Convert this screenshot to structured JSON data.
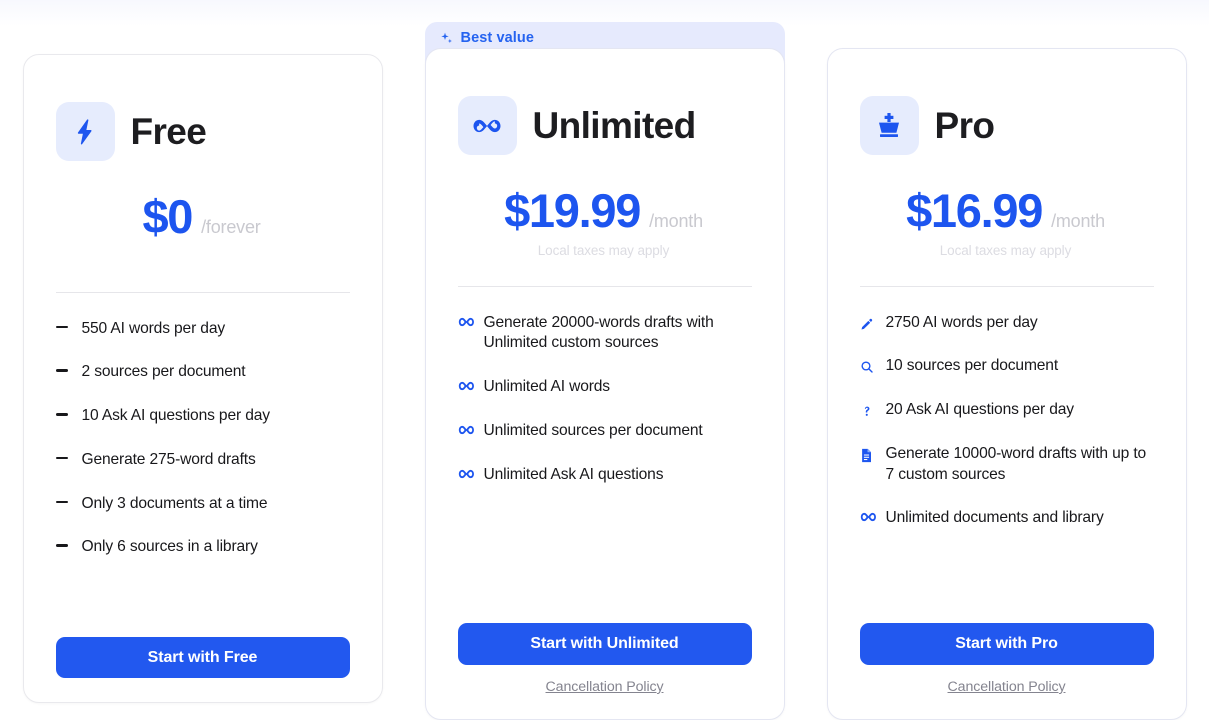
{
  "theme": {
    "accent_blue": "#1d55ef",
    "button_blue": "#2258ef",
    "icon_tile_bg": "#e6ecfd",
    "badge_bg": "#e6eafd",
    "card_border": "#e9e9ed",
    "muted_text": "#c9c9cf",
    "note_text": "#dcdce2",
    "heading_text": "#1d1d20"
  },
  "plans": [
    {
      "id": "free",
      "name": "Free",
      "icon": "lightning-bolt-icon",
      "price": "$0",
      "period": "/forever",
      "note": "",
      "bullet_style": "dash",
      "features": [
        {
          "icon": "dash-icon",
          "text": "550 AI words per day"
        },
        {
          "icon": "dash-icon",
          "text": "2 sources per document"
        },
        {
          "icon": "dash-icon",
          "text": "10 Ask AI questions per day"
        },
        {
          "icon": "dash-icon",
          "text": "Generate 275-word drafts"
        },
        {
          "icon": "dash-icon",
          "text": "Only 3 documents at a time"
        },
        {
          "icon": "dash-icon",
          "text": "Only 6 sources in a library"
        }
      ],
      "cta_label": "Start with Free",
      "policy_label": ""
    },
    {
      "id": "unlimited",
      "name": "Unlimited",
      "icon": "infinity-icon",
      "badge": {
        "label": "Best value",
        "icon": "sparkles-icon"
      },
      "price": "$19.99",
      "period": "/month",
      "note": "Local taxes may apply",
      "bullet_style": "infinity",
      "features": [
        {
          "icon": "infinity-icon",
          "text": "Generate 20000-words drafts with Unlimited custom sources"
        },
        {
          "icon": "infinity-icon",
          "text": "Unlimited AI words"
        },
        {
          "icon": "infinity-icon",
          "text": "Unlimited sources per document"
        },
        {
          "icon": "infinity-icon",
          "text": "Unlimited Ask AI questions"
        }
      ],
      "cta_label": "Start with Unlimited",
      "policy_label": "Cancellation Policy"
    },
    {
      "id": "pro",
      "name": "Pro",
      "icon": "chess-king-icon",
      "price": "$16.99",
      "period": "/month",
      "note": "Local taxes may apply",
      "bullet_style": "mixed",
      "features": [
        {
          "icon": "pencil-icon",
          "text": "2750 AI words per day"
        },
        {
          "icon": "search-icon",
          "text": "10 sources per document"
        },
        {
          "icon": "question-mark-icon",
          "text": "20 Ask AI questions per day"
        },
        {
          "icon": "document-icon",
          "text": "Generate 10000-word drafts with up to 7 custom sources"
        },
        {
          "icon": "infinity-icon",
          "text": "Unlimited documents and library"
        }
      ],
      "cta_label": "Start with Pro",
      "policy_label": "Cancellation Policy"
    }
  ]
}
